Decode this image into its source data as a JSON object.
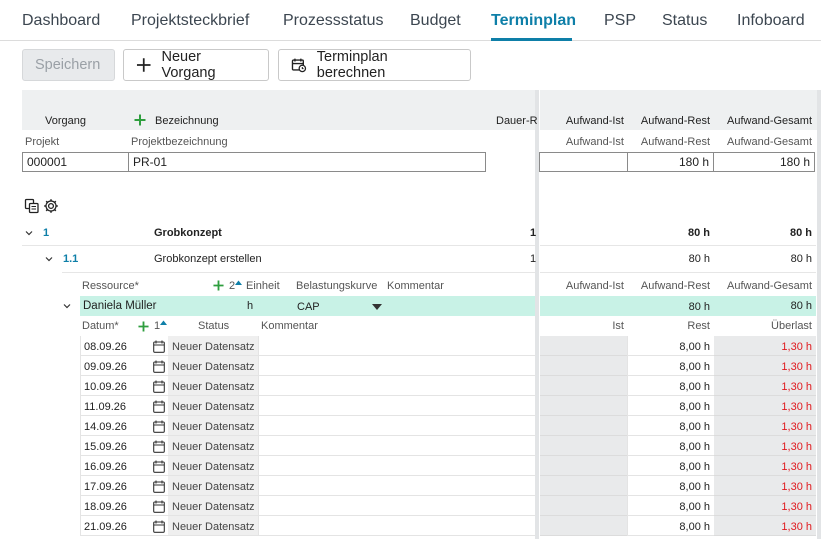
{
  "tabs": [
    "Dashboard",
    "Projektsteckbrief",
    "Prozessstatus",
    "Budget",
    "Terminplan",
    "PSP",
    "Status",
    "Infoboard"
  ],
  "active_tab": "Terminplan",
  "toolbar": {
    "save_label": "Speichern",
    "new_task_label": "Neuer Vorgang",
    "calc_label": "Terminplan berechnen"
  },
  "header": {
    "vorgang": "Vorgang",
    "bezeichnung": "Bezeichnung",
    "dauer": "Dauer-R",
    "aufwand_ist": "Aufwand-Ist",
    "aufwand_rest": "Aufwand-Rest",
    "aufwand_gesamt": "Aufwand-Gesamt"
  },
  "project": {
    "projekt_label": "Projekt",
    "bezeichnung_label": "Projektbezeichnung",
    "projekt_value": "000001",
    "bezeichnung_value": "PR-01",
    "aufwand_ist_label": "Aufwand-Ist",
    "aufwand_rest_label": "Aufwand-Rest",
    "aufwand_gesamt_label": "Aufwand-Gesamt",
    "aufwand_ist_value": "",
    "aufwand_rest_value": "180 h",
    "aufwand_gesamt_value": "180 h"
  },
  "tasks": [
    {
      "id": "1",
      "name": "Grobkonzept",
      "dauer": "1",
      "rest": "80 h",
      "gesamt": "80 h"
    },
    {
      "id": "1.1",
      "name": "Grobkonzept erstellen",
      "dauer": "1",
      "rest": "80 h",
      "gesamt": "80 h"
    }
  ],
  "resource_header": {
    "ressource": "Ressource*",
    "sort_count": "2",
    "einheit": "Einheit",
    "belastungskurve": "Belastungskurve",
    "kommentar": "Kommentar",
    "aufwand_ist": "Aufwand-Ist",
    "aufwand_rest": "Aufwand-Rest",
    "aufwand_gesamt": "Aufwand-Gesamt"
  },
  "resource": {
    "name": "Daniela Müller",
    "einheit": "h",
    "kurve": "CAP",
    "rest": "80 h",
    "gesamt": "80 h"
  },
  "date_header": {
    "datum": "Datum*",
    "sort_count": "1",
    "status": "Status",
    "kommentar": "Kommentar",
    "ist": "Ist",
    "rest": "Rest",
    "ueberlast": "Überlast"
  },
  "date_rows": [
    {
      "datum": "08.09.26",
      "status": "Neuer Datensatz",
      "rest": "8,00 h",
      "ueberlast": "1,30 h"
    },
    {
      "datum": "09.09.26",
      "status": "Neuer Datensatz",
      "rest": "8,00 h",
      "ueberlast": "1,30 h"
    },
    {
      "datum": "10.09.26",
      "status": "Neuer Datensatz",
      "rest": "8,00 h",
      "ueberlast": "1,30 h"
    },
    {
      "datum": "11.09.26",
      "status": "Neuer Datensatz",
      "rest": "8,00 h",
      "ueberlast": "1,30 h"
    },
    {
      "datum": "14.09.26",
      "status": "Neuer Datensatz",
      "rest": "8,00 h",
      "ueberlast": "1,30 h"
    },
    {
      "datum": "15.09.26",
      "status": "Neuer Datensatz",
      "rest": "8,00 h",
      "ueberlast": "1,30 h"
    },
    {
      "datum": "16.09.26",
      "status": "Neuer Datensatz",
      "rest": "8,00 h",
      "ueberlast": "1,30 h"
    },
    {
      "datum": "17.09.26",
      "status": "Neuer Datensatz",
      "rest": "8,00 h",
      "ueberlast": "1,30 h"
    },
    {
      "datum": "18.09.26",
      "status": "Neuer Datensatz",
      "rest": "8,00 h",
      "ueberlast": "1,30 h"
    },
    {
      "datum": "21.09.26",
      "status": "Neuer Datensatz",
      "rest": "8,00 h",
      "ueberlast": "1,30 h"
    }
  ],
  "colors": {
    "accent": "#0e7fa8",
    "add_green": "#2e9e3e",
    "overload_red": "#e0191e",
    "resource_highlight": "#c8f2e6"
  }
}
